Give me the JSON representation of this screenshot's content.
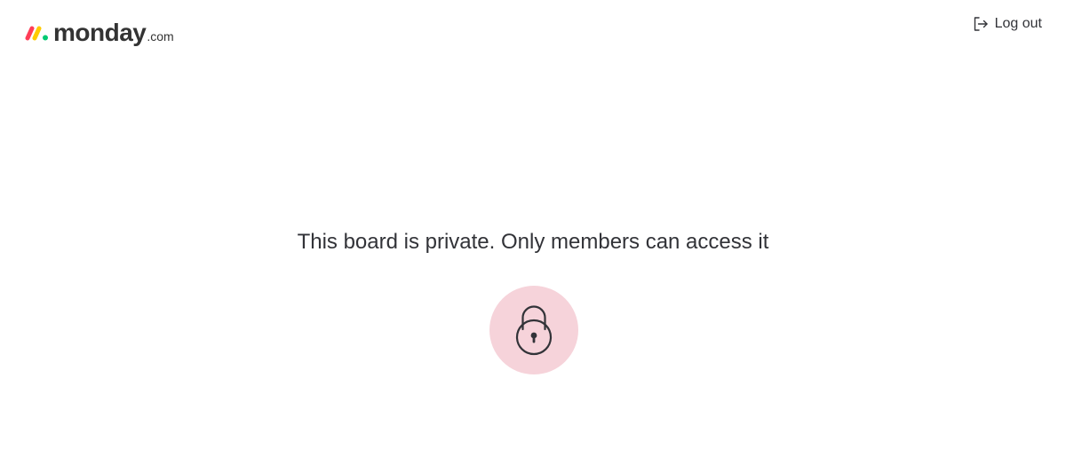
{
  "header": {
    "logo": {
      "wordmark": "monday",
      "suffix": ".com",
      "colors": [
        "#ff3d57",
        "#ffcb00",
        "#00ca72"
      ]
    },
    "logout": {
      "label": "Log out",
      "icon": "logout-icon"
    }
  },
  "main": {
    "message": "This board is private. Only members can access it",
    "lock": {
      "icon": "lock-icon",
      "circle_color": "#f6d3da"
    }
  }
}
